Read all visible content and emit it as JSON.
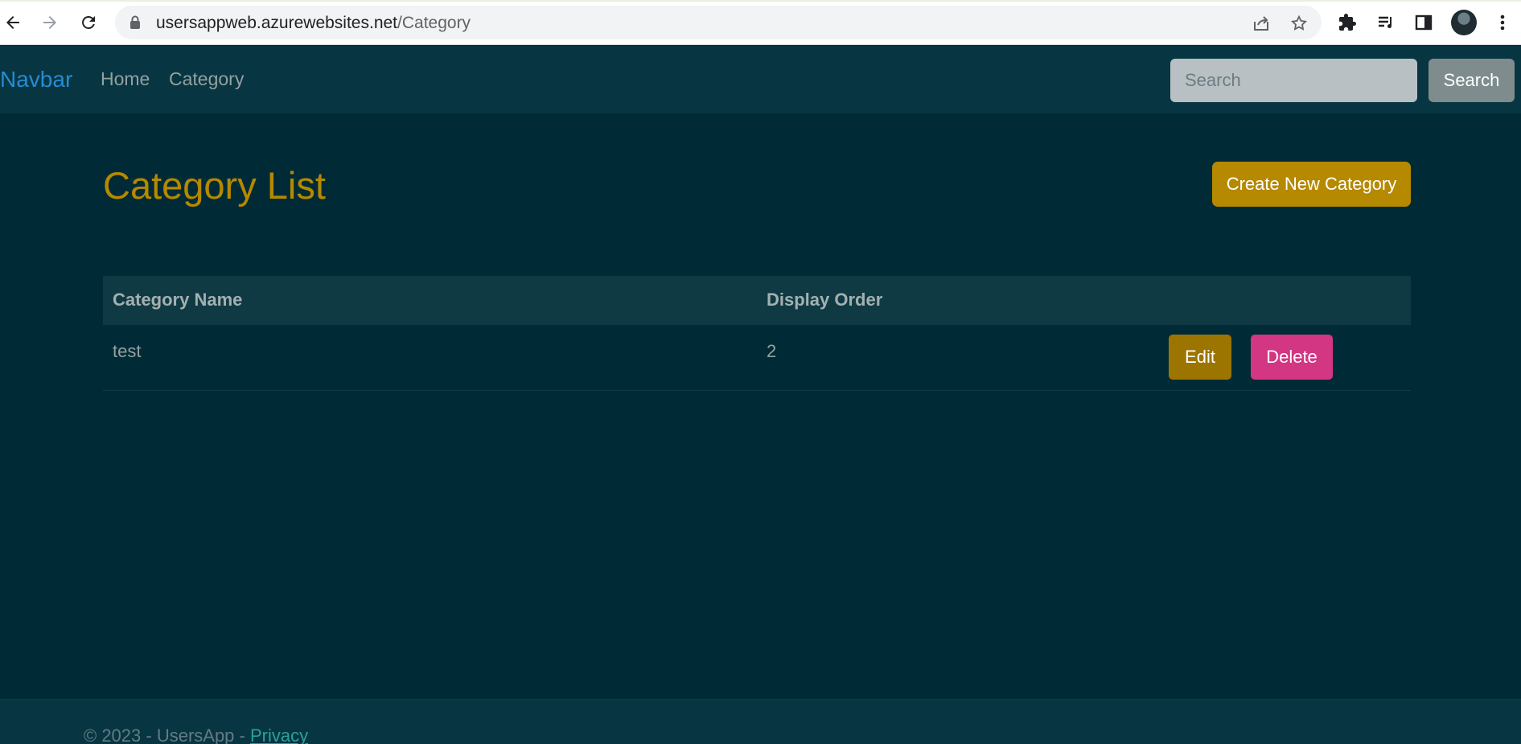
{
  "browser": {
    "url_host": "usersappweb.azurewebsites.net",
    "url_path": "/Category"
  },
  "navbar": {
    "brand": "Navbar",
    "links": [
      "Home",
      "Category"
    ],
    "search_placeholder": "Search",
    "search_button": "Search"
  },
  "main": {
    "title": "Category List",
    "create_button": "Create New Category",
    "table": {
      "headers": [
        "Category Name",
        "Display Order"
      ],
      "rows": [
        {
          "name": "test",
          "order": "2",
          "edit": "Edit",
          "delete": "Delete"
        }
      ]
    }
  },
  "footer": {
    "text": "© 2023 - UsersApp - ",
    "link": "Privacy"
  },
  "colors": {
    "background": "#002b36",
    "navbar": "#073642",
    "brand": "#268bd2",
    "accent": "#b58900",
    "danger": "#d33682"
  }
}
